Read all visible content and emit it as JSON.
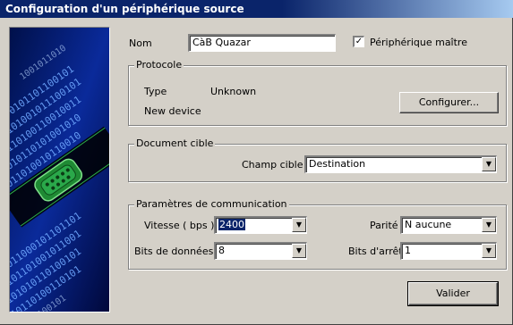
{
  "window": {
    "title": "Configuration d'un périphérique source"
  },
  "form": {
    "nom_label": "Nom",
    "nom_value": "CàB Quazar",
    "master_label": "Périphérique maître",
    "master_checked": true,
    "protocole": {
      "legend": "Protocole",
      "type_label": "Type",
      "type_value": "Unknown",
      "device_text": "New device",
      "configure_button": "Configurer..."
    },
    "document": {
      "legend": "Document cible",
      "champ_label": "Champ cible",
      "champ_value": "Destination"
    },
    "communication": {
      "legend": "Paramètres de communication",
      "vitesse_label": "Vitesse ( bps )",
      "vitesse_value": "2400",
      "parite_label": "Parité",
      "parite_value": "N aucune",
      "bits_donnees_label": "Bits de données",
      "bits_donnees_value": "8",
      "bits_arret_label": "Bits d'arrêt",
      "bits_arret_value": "1"
    },
    "valider_button": "Valider"
  },
  "icons": {
    "checkbox": "checkmark-icon",
    "dropdown": "dropdown-arrow-icon",
    "side": "serial-connector-binary-image"
  }
}
